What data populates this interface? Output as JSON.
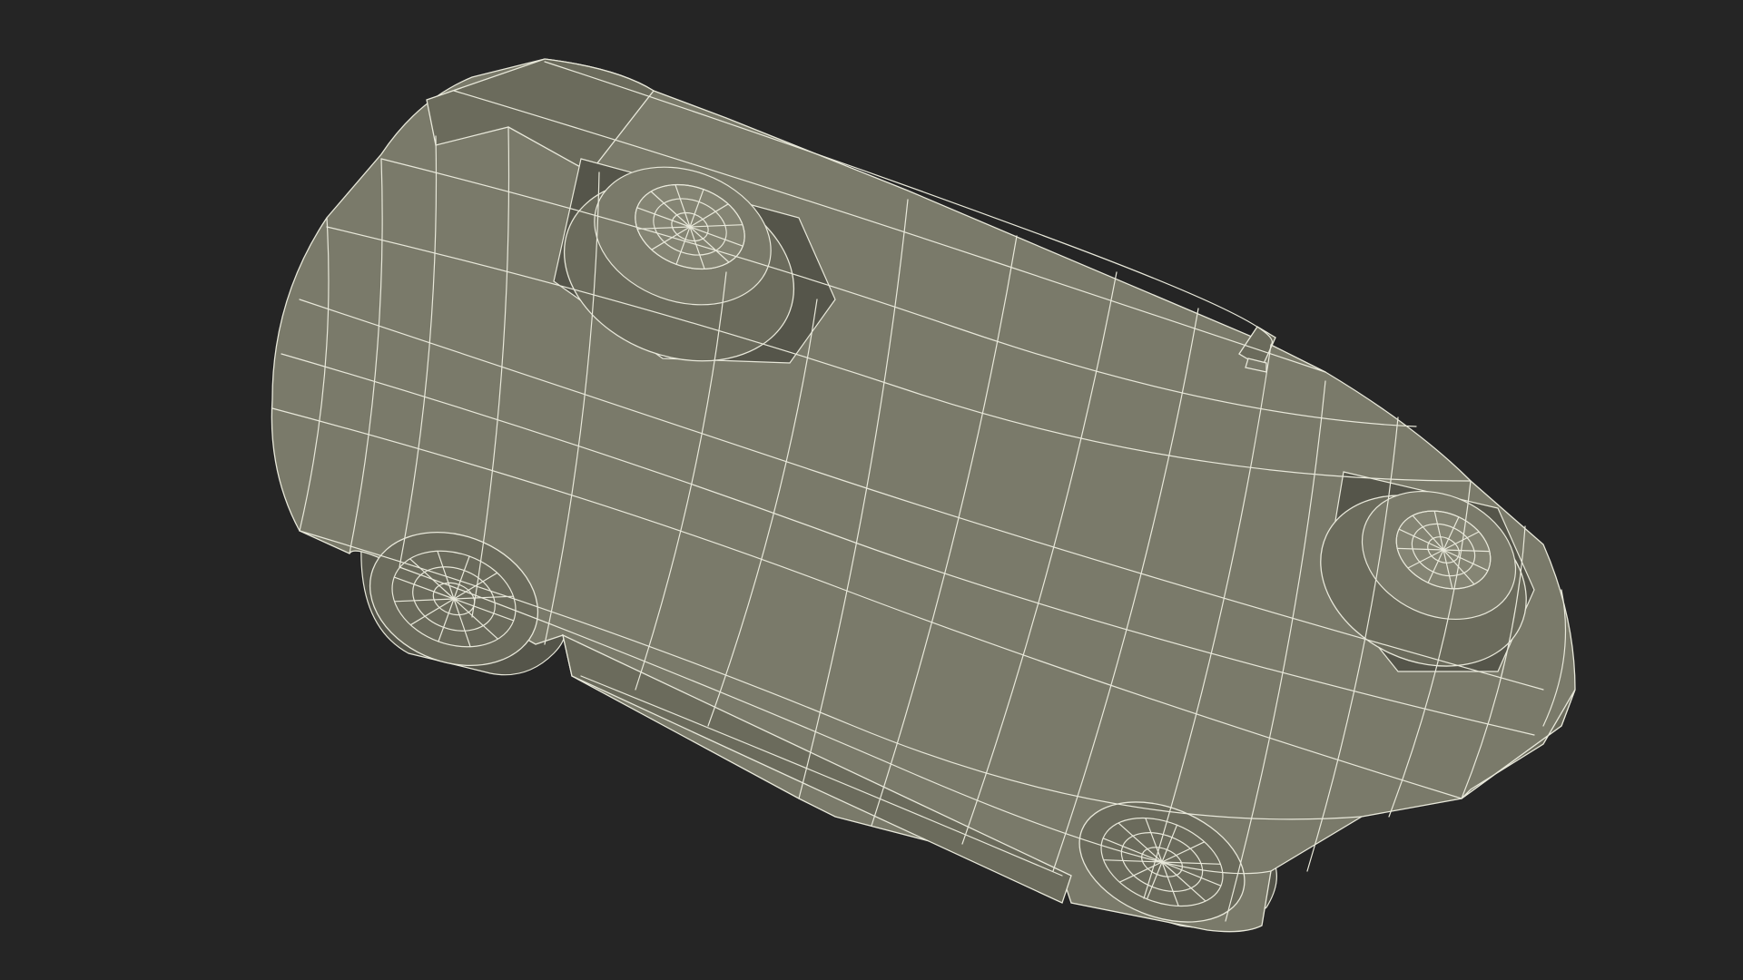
{
  "scene": {
    "subject": "car-wireframe-bottom-view",
    "colors": {
      "background": "#252525",
      "body": "#7a7a6a",
      "body_dark": "#6b6b5c",
      "body_light": "#858574",
      "shadow": "#55554a",
      "wire": "#e8e8da"
    }
  }
}
